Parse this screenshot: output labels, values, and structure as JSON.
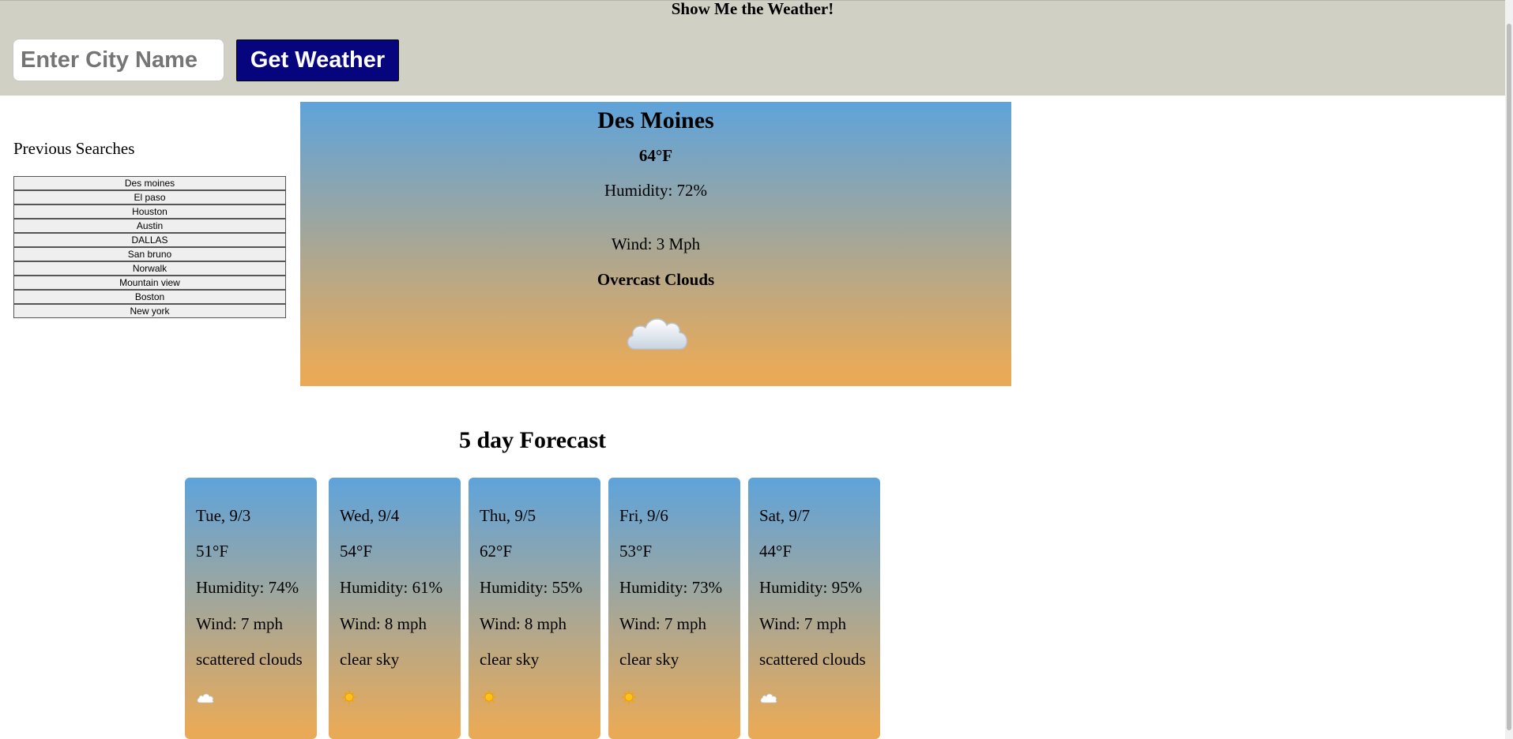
{
  "header": {
    "title": "Show Me the Weather!",
    "city_placeholder": "Enter City Name",
    "city_value": "",
    "button_label": "Get Weather"
  },
  "sidebar": {
    "heading": "Previous Searches",
    "items": [
      "Des moines",
      "El paso",
      "Houston",
      "Austin",
      "DALLAS",
      "San bruno",
      "Norwalk",
      "Mountain view",
      "Boston",
      "New york"
    ]
  },
  "current": {
    "city": "Des Moines",
    "temp": "64°F",
    "humidity": "Humidity: 72%",
    "wind": "Wind: 3 Mph",
    "description": "Overcast Clouds",
    "icon": "overcast-cloud-icon"
  },
  "forecast": {
    "title": "5 day Forecast",
    "days": [
      {
        "date": "Tue, 9/3",
        "temp": "51°F",
        "humidity": "Humidity: 74%",
        "wind": "Wind: 7 mph",
        "description": "scattered clouds",
        "icon": "cloud-icon"
      },
      {
        "date": "Wed, 9/4",
        "temp": "54°F",
        "humidity": "Humidity: 61%",
        "wind": "Wind: 8 mph",
        "description": "clear sky",
        "icon": "sun-icon"
      },
      {
        "date": "Thu, 9/5",
        "temp": "62°F",
        "humidity": "Humidity: 55%",
        "wind": "Wind: 8 mph",
        "description": "clear sky",
        "icon": "sun-icon"
      },
      {
        "date": "Fri, 9/6",
        "temp": "53°F",
        "humidity": "Humidity: 73%",
        "wind": "Wind: 7 mph",
        "description": "clear sky",
        "icon": "sun-icon"
      },
      {
        "date": "Sat, 9/7",
        "temp": "44°F",
        "humidity": "Humidity: 95%",
        "wind": "Wind: 7 mph",
        "description": "scattered clouds",
        "icon": "cloud-icon"
      }
    ]
  },
  "colors": {
    "header_bg": "#d1d0c4",
    "button_bg": "#06057e",
    "gradient_top": "#5ea3db",
    "gradient_bottom": "#e9aa58"
  }
}
